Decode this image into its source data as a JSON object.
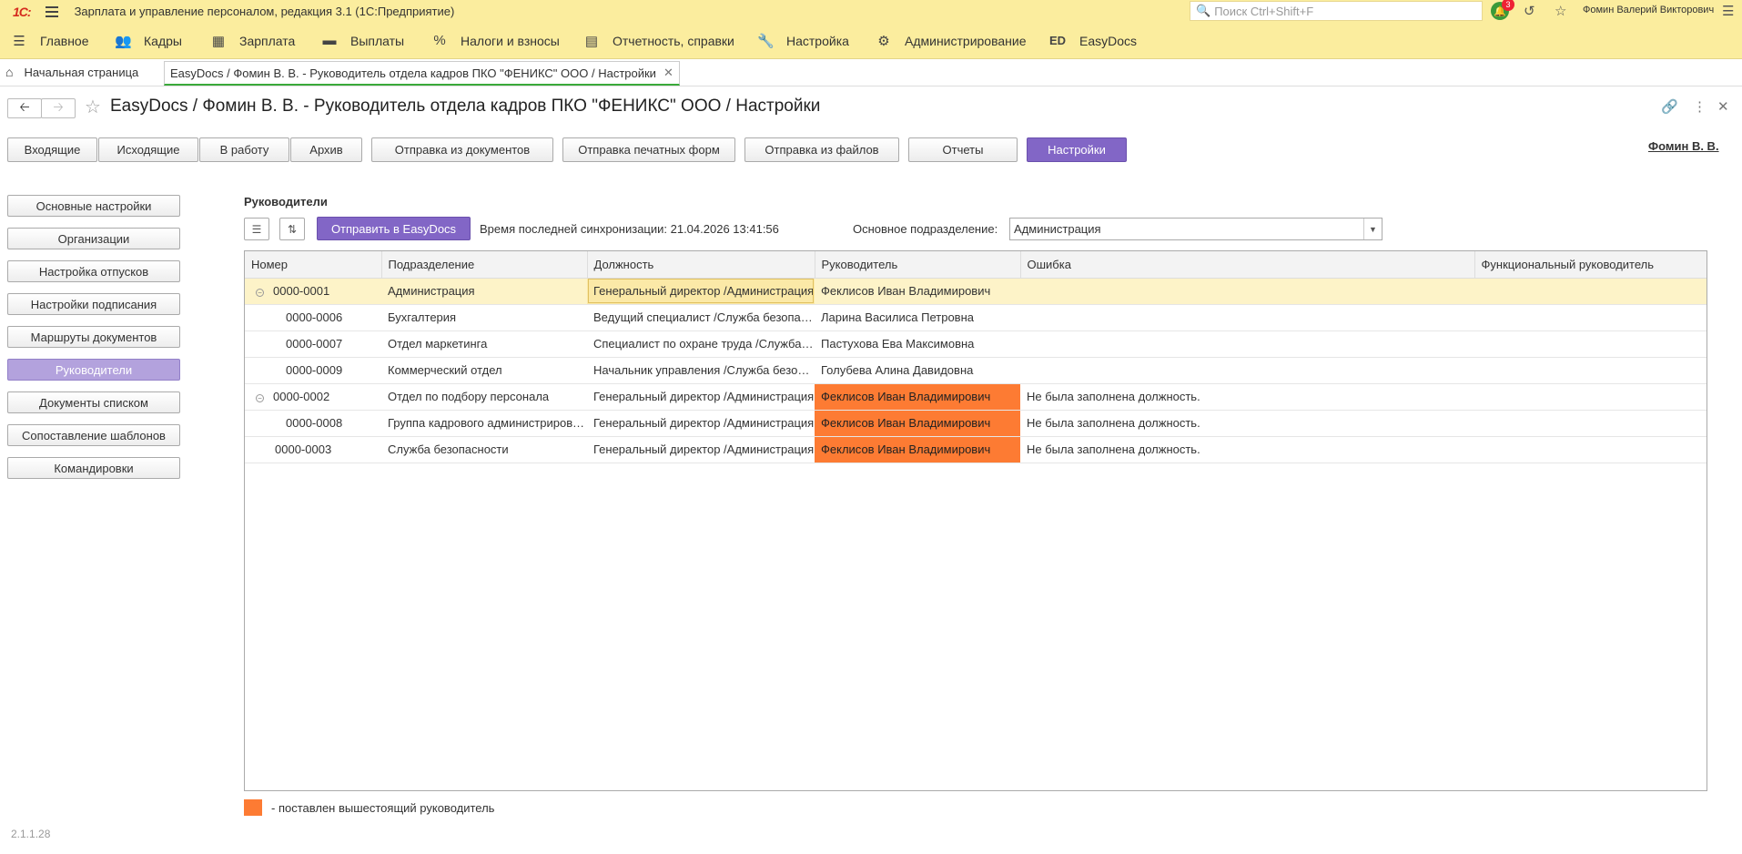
{
  "app": {
    "logo": "1С:",
    "title": "Зарплата и управление персоналом, редакция 3.1  (1С:Предприятие)",
    "search_placeholder": "Поиск Ctrl+Shift+F",
    "notifications": "3",
    "user": "Фомин Валерий Викторович"
  },
  "sections": [
    {
      "icon": "☰",
      "label": "Главное"
    },
    {
      "icon": "👥",
      "label": "Кадры"
    },
    {
      "icon": "▦",
      "label": "Зарплата"
    },
    {
      "icon": "▬",
      "label": "Выплаты"
    },
    {
      "icon": "%",
      "label": "Налоги и взносы"
    },
    {
      "icon": "▤",
      "label": "Отчетность, справки"
    },
    {
      "icon": "🔧",
      "label": "Настройка"
    },
    {
      "icon": "⚙",
      "label": "Администрирование"
    },
    {
      "icon": "ED",
      "label": "EasyDocs"
    }
  ],
  "tabs": {
    "home": "Начальная страница",
    "active": "EasyDocs / Фомин В. В. - Руководитель отдела кадров ПКО \"ФЕНИКС\" ООО / Настройки"
  },
  "page": {
    "title": "EasyDocs / Фомин В. В. - Руководитель отдела кадров ПКО \"ФЕНИКС\" ООО / Настройки",
    "user_link": "Фомин В. В."
  },
  "toolbar": [
    "Входящие",
    "Исходящие",
    "В работу",
    "Архив",
    "Отправка из документов",
    "Отправка печатных форм",
    "Отправка из файлов",
    "Отчеты",
    "Настройки"
  ],
  "sidebar": [
    "Основные настройки",
    "Организации",
    "Настройка отпусков",
    "Настройки подписания",
    "Маршруты документов",
    "Руководители",
    "Документы списком",
    "Сопоставление шаблонов",
    "Командировки"
  ],
  "content": {
    "section_title": "Руководители",
    "send_button": "Отправить в EasyDocs",
    "sync_text": "Время последней синхронизации: 21.04.2026 13:41:56",
    "dept_label": "Основное подразделение:",
    "dept_value": "Администрация"
  },
  "grid": {
    "columns": [
      "Номер",
      "Подразделение",
      "Должность",
      "Руководитель",
      "Ошибка",
      "Функциональный руководитель"
    ],
    "rows": [
      {
        "num": "0000-0001",
        "dept": "Администрация",
        "pos": "Генеральный директор /Администрация",
        "head": "Феклисов Иван Владимирович",
        "error": "",
        "func": ""
      },
      {
        "num": "0000-0006",
        "dept": "Бухгалтерия",
        "pos": "Ведущий специалист /Служба безопасности",
        "head": "Ларина Василиса Петровна",
        "error": "",
        "func": ""
      },
      {
        "num": "0000-0007",
        "dept": "Отдел маркетинга",
        "pos": "Специалист по охране труда /Служба безопасности",
        "head": "Пастухова Ева Максимовна",
        "error": "",
        "func": ""
      },
      {
        "num": "0000-0009",
        "dept": "Коммерческий отдел",
        "pos": "Начальник управления /Служба безопасности",
        "head": "Голубева Алина Давидовна",
        "error": "",
        "func": ""
      },
      {
        "num": "0000-0002",
        "dept": "Отдел по подбору персонала",
        "pos": "Генеральный директор /Администрация",
        "head": "Феклисов Иван Владимирович",
        "error": "Не была заполнена должность.",
        "func": ""
      },
      {
        "num": "0000-0008",
        "dept": "Группа кадрового администрирования",
        "pos": "Генеральный директор /Администрация",
        "head": "Феклисов Иван Владимирович",
        "error": "Не была заполнена должность.",
        "func": ""
      },
      {
        "num": "0000-0003",
        "dept": "Служба безопасности",
        "pos": "Генеральный директор /Администрация",
        "head": "Феклисов Иван Владимирович",
        "error": "Не была заполнена должность.",
        "func": ""
      }
    ]
  },
  "legend": "- поставлен вышестоящий руководитель",
  "version": "2.1.1.28",
  "colors": {
    "accent": "#8266c6",
    "error": "#fd7b33",
    "header_bg": "#fbed9e"
  }
}
